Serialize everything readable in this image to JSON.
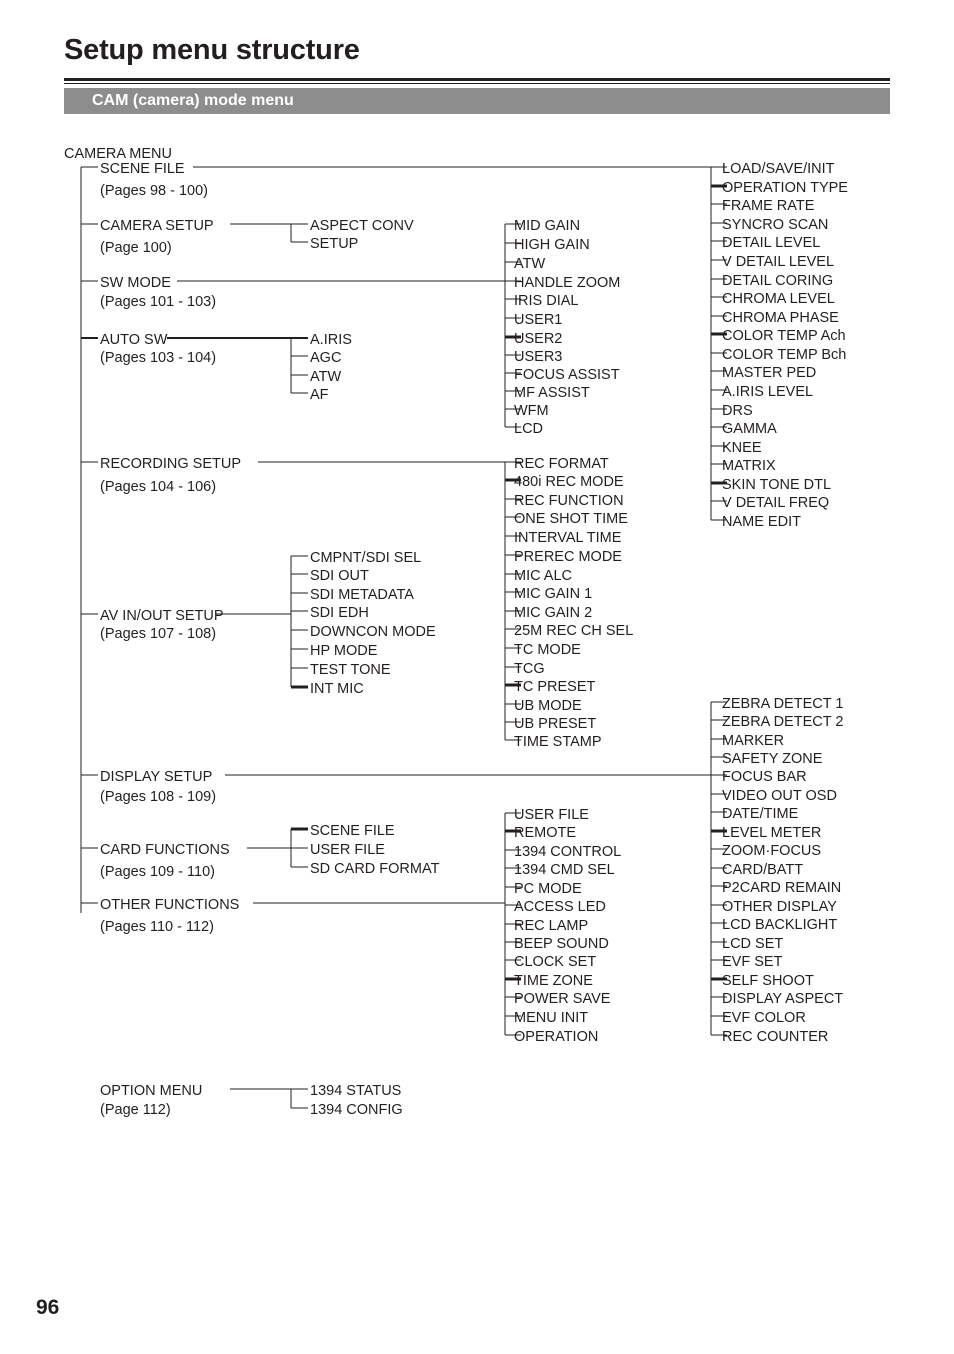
{
  "header": {
    "title": "Setup menu structure",
    "section_band": "CAM (camera) mode menu",
    "band_color": "#8d8d8d"
  },
  "folio": "96",
  "tree": {
    "root": "CAMERA MENU",
    "level1": [
      {
        "label": "SCENE FILE",
        "pages": "(Pages 98 - 100)"
      },
      {
        "label": "CAMERA SETUP",
        "pages": "(Page 100)"
      },
      {
        "label": "SW MODE",
        "pages": "(Pages 101 - 103)"
      },
      {
        "label": "AUTO SW",
        "pages": "(Pages 103 - 104)"
      },
      {
        "label": "RECORDING SETUP",
        "pages": "(Pages 104 - 106)"
      },
      {
        "label": "AV IN/OUT SETUP",
        "pages": "(Pages 107 - 108)"
      },
      {
        "label": "DISPLAY SETUP",
        "pages": "(Pages 108 - 109)"
      },
      {
        "label": "CARD FUNCTIONS",
        "pages": "(Pages 109 - 110)"
      },
      {
        "label": "OTHER FUNCTIONS",
        "pages": "(Pages 110 - 112)"
      }
    ],
    "camera_setup_children": [
      "ASPECT CONV",
      "SETUP"
    ],
    "auto_sw_children": [
      "A.IRIS",
      "AGC",
      "ATW",
      "AF"
    ],
    "av_inout_children": [
      "CMPNT/SDI SEL",
      "SDI OUT",
      "SDI METADATA",
      "SDI EDH",
      "DOWNCON MODE",
      "HP MODE",
      "TEST TONE",
      "INT MIC"
    ],
    "card_functions_children": [
      "SCENE FILE",
      "USER FILE",
      "SD CARD FORMAT"
    ],
    "sw_mode_children": [
      "MID GAIN",
      "HIGH GAIN",
      "ATW",
      "HANDLE ZOOM",
      "IRIS DIAL",
      "USER1",
      "USER2",
      "USER3",
      "FOCUS ASSIST",
      "MF ASSIST",
      "WFM",
      "LCD"
    ],
    "recording_setup_children": [
      "REC FORMAT",
      "480i REC MODE",
      "REC FUNCTION",
      "ONE SHOT TIME",
      "INTERVAL TIME",
      "PREREC MODE",
      "MIC ALC",
      "MIC GAIN 1",
      "MIC GAIN 2",
      "25M REC CH SEL",
      "TC MODE",
      "TCG",
      "TC PRESET",
      "UB MODE",
      "UB PRESET",
      "TIME STAMP"
    ],
    "other_functions_children": [
      "USER FILE",
      "REMOTE",
      "1394 CONTROL",
      "1394 CMD SEL",
      "PC MODE",
      "ACCESS LED",
      "REC LAMP",
      "BEEP SOUND",
      "CLOCK SET",
      "TIME ZONE",
      "POWER SAVE",
      "MENU INIT",
      "OPERATION"
    ],
    "scene_file_children": [
      "LOAD/SAVE/INIT",
      "OPERATION TYPE",
      "FRAME RATE",
      "SYNCRO SCAN",
      "DETAIL LEVEL",
      "V DETAIL LEVEL",
      "DETAIL CORING",
      "CHROMA LEVEL",
      "CHROMA PHASE",
      "COLOR TEMP Ach",
      "COLOR TEMP Bch",
      "MASTER PED",
      "A.IRIS LEVEL",
      "DRS",
      "GAMMA",
      "KNEE",
      "MATRIX",
      "SKIN TONE DTL",
      "V DETAIL FREQ",
      "NAME EDIT"
    ],
    "display_setup_children": [
      "ZEBRA DETECT 1",
      "ZEBRA DETECT 2",
      "MARKER",
      "SAFETY ZONE",
      "FOCUS BAR",
      "VIDEO OUT OSD",
      "DATE/TIME",
      "LEVEL METER",
      "ZOOM·FOCUS",
      "CARD/BATT",
      "P2CARD REMAIN",
      "OTHER DISPLAY",
      "LCD BACKLIGHT",
      "LCD SET",
      "EVF SET",
      "SELF SHOOT",
      "DISPLAY ASPECT",
      "EVF COLOR",
      "REC COUNTER"
    ]
  },
  "option": {
    "label": "OPTION MENU",
    "pages": "(Page 112)",
    "children": [
      "1394 STATUS",
      "1394 CONFIG"
    ]
  }
}
